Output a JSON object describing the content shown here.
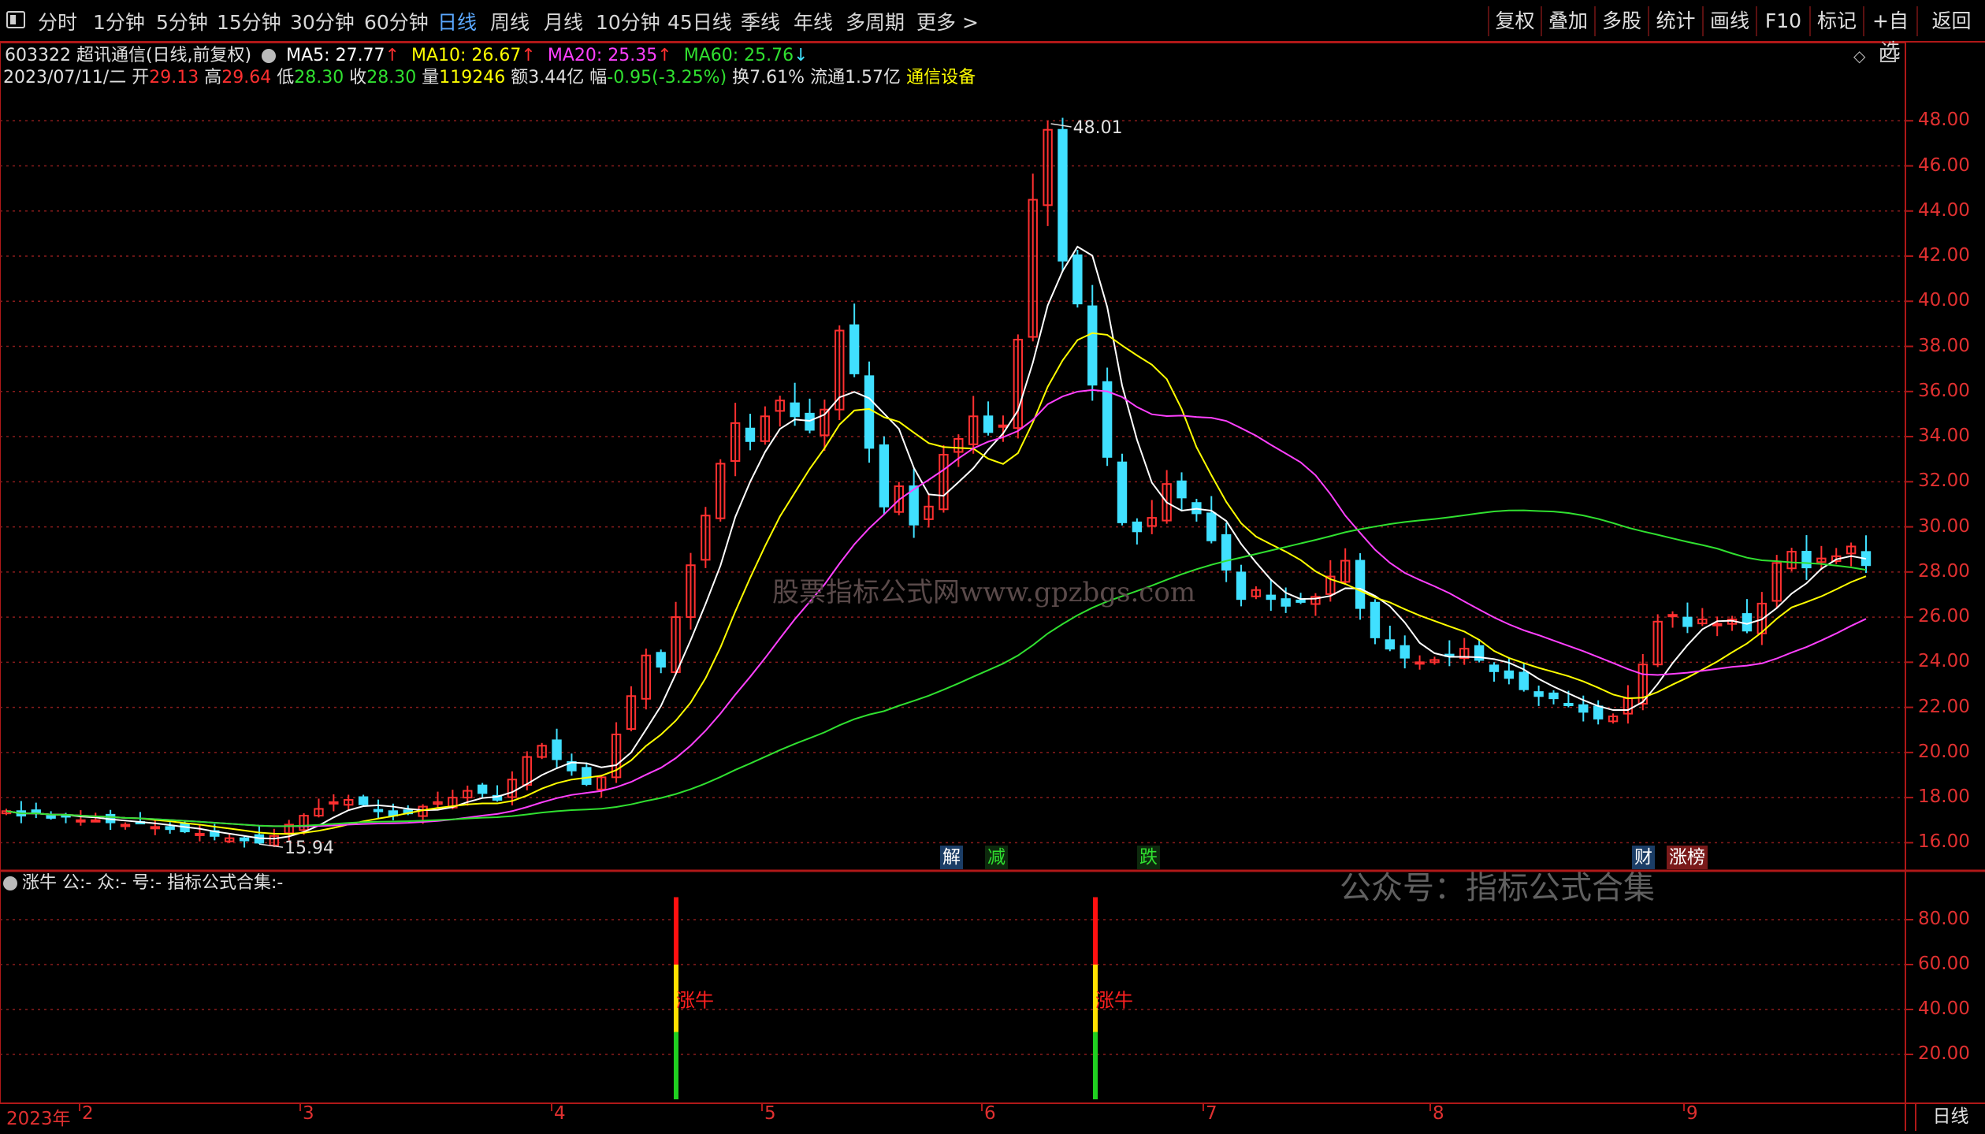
{
  "toolbar": {
    "left": [
      "分时",
      "1分钟",
      "5分钟",
      "15分钟",
      "30分钟",
      "60分钟",
      "日线",
      "周线",
      "月线",
      "10分钟",
      "45日线",
      "季线",
      "年线",
      "多周期",
      "更多 >"
    ],
    "active": "日线",
    "right": [
      "复权",
      "叠加",
      "多股",
      "统计",
      "画线",
      "F10",
      "标记",
      "+自选",
      "返回"
    ]
  },
  "stock": {
    "title": "603322 超讯通信(日线,前复权)",
    "ma5": "MA5: 27.77",
    "ma10": "MA10: 26.67",
    "ma20": "MA20: 25.35",
    "ma60": "MA60: 25.76",
    "date": "2023/07/11/二",
    "open_label": "开",
    "open": "29.13",
    "high_label": "高",
    "high": "29.64",
    "low_label": "低",
    "low": "28.30",
    "close_label": "收",
    "close": "28.30",
    "vol_label": "量",
    "vol": "119246",
    "amt_label": "额",
    "amt": "3.44亿",
    "chg_label": "幅",
    "chg": "-0.95(-3.25%)",
    "turn": "换7.61%",
    "float": "流通1.57亿",
    "sector": "通信设备"
  },
  "colors": {
    "up": "#ff3030",
    "down": "#40e0ff",
    "ma5": "#ffffff",
    "ma10": "#ffff00",
    "ma20": "#ff40ff",
    "ma60": "#30e030",
    "grid": "#8a1c1c"
  },
  "chart_data": {
    "type": "candlestick",
    "price_ylim": [
      15,
      50
    ],
    "price_ticks": [
      "48.00",
      "46.00",
      "44.00",
      "42.00",
      "40.00",
      "38.00",
      "36.00",
      "34.00",
      "32.00",
      "30.00",
      "28.00",
      "26.00",
      "24.00",
      "22.00",
      "20.00",
      "18.00",
      "16.00"
    ],
    "high_label": "48.01",
    "low_label": "15.94",
    "series_close": [
      17.4,
      17.2,
      17.3,
      17.1,
      17.2,
      17.0,
      17.0,
      16.9,
      16.8,
      16.9,
      16.7,
      16.6,
      16.5,
      16.4,
      16.3,
      16.2,
      16.1,
      16.0,
      16.3,
      16.8,
      17.2,
      17.5,
      17.8,
      17.9,
      17.7,
      17.4,
      17.2,
      17.3,
      17.6,
      17.8,
      18.0,
      18.3,
      18.2,
      17.9,
      18.8,
      19.8,
      20.3,
      19.7,
      19.2,
      18.6,
      18.9,
      20.8,
      22.5,
      24.3,
      23.8,
      26.0,
      28.3,
      30.5,
      32.8,
      34.6,
      33.8,
      34.9,
      35.6,
      34.9,
      34.3,
      35.2,
      38.7,
      36.8,
      33.5,
      30.9,
      31.8,
      30.1,
      30.9,
      33.2,
      33.9,
      34.9,
      34.2,
      34.5,
      38.3,
      44.5,
      47.6,
      41.8,
      39.9,
      36.3,
      33.1,
      30.2,
      29.8,
      30.4,
      31.9,
      31.3,
      30.6,
      29.4,
      28.1,
      26.8,
      27.2,
      26.8,
      26.5,
      26.7,
      26.9,
      27.8,
      28.5,
      26.4,
      25.1,
      24.6,
      24.2,
      24.0,
      24.1,
      24.3,
      24.6,
      24.1,
      23.6,
      23.3,
      22.8,
      22.5,
      22.4,
      22.1,
      21.8,
      21.5,
      21.6,
      22.4,
      23.9,
      25.8,
      26.1,
      25.6,
      25.9,
      25.7,
      25.9,
      25.4,
      26.6,
      28.4,
      28.9,
      28.2,
      28.6,
      28.7,
      29.13,
      28.3
    ],
    "ma5_values_from_label": 27.77,
    "indicator_ylim": [
      0,
      100
    ],
    "indicator_ticks": [
      "80.00",
      "60.00",
      "40.00",
      "20.00"
    ],
    "signals": [
      {
        "x_index": 44,
        "value": 90
      },
      {
        "x_index": 71,
        "value": 90
      }
    ],
    "signal_label": "涨牛"
  },
  "events": [
    {
      "label": "解",
      "color": "#ffffff",
      "bg": "#1b3d66"
    },
    {
      "label": "减",
      "color": "#30e030",
      "bg": "#0d2a0d"
    },
    {
      "label": "跌",
      "color": "#30e030",
      "bg": "#0d2a0d"
    },
    {
      "label": "财",
      "color": "#ffffff",
      "bg": "#1b3d66"
    },
    {
      "label": "涨榜",
      "color": "#ffffff",
      "bg": "#7a1a1a"
    }
  ],
  "indicator": {
    "title": "涨牛 公:- 众:- 号:- 指标公式合集:-"
  },
  "watermarks": {
    "site": "股票指标公式网www.gpzbgs.com",
    "wechat": "公众号：指标公式合集"
  },
  "axis_dates": [
    "2023年",
    "2",
    "3",
    "4",
    "5",
    "6",
    "7",
    "8",
    "9"
  ],
  "period_label": "日线"
}
